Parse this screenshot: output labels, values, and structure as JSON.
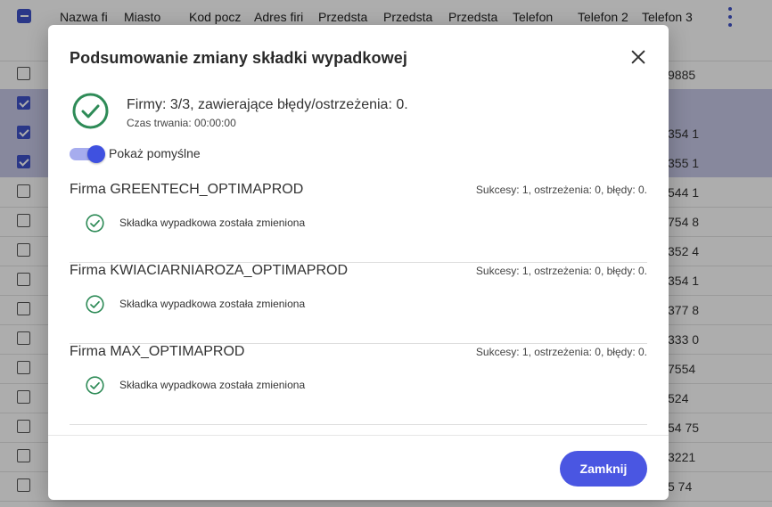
{
  "grid": {
    "columns": [
      "Nazwa fi",
      "Miasto",
      "Kod pocz",
      "Adres firi",
      "Przedsta",
      "Przedsta",
      "Przedsta",
      "Telefon",
      "Telefon 2",
      "Telefon 3"
    ],
    "rows": [
      {
        "checked": false,
        "selected": false,
        "value": "9885"
      },
      {
        "checked": true,
        "selected": true,
        "value": ""
      },
      {
        "checked": true,
        "selected": true,
        "value": "354 1"
      },
      {
        "checked": true,
        "selected": true,
        "value": "355 1"
      },
      {
        "checked": false,
        "selected": false,
        "value": "544 1"
      },
      {
        "checked": false,
        "selected": false,
        "value": "754 8"
      },
      {
        "checked": false,
        "selected": false,
        "value": "352 4"
      },
      {
        "checked": false,
        "selected": false,
        "value": "354 1"
      },
      {
        "checked": false,
        "selected": false,
        "value": "377 8"
      },
      {
        "checked": false,
        "selected": false,
        "value": "333 0"
      },
      {
        "checked": false,
        "selected": false,
        "value": "7554"
      },
      {
        "checked": false,
        "selected": false,
        "value": "524"
      },
      {
        "checked": false,
        "selected": false,
        "value": "54 75"
      },
      {
        "checked": false,
        "selected": false,
        "value": "3221"
      },
      {
        "checked": false,
        "selected": false,
        "value": "5 74"
      }
    ]
  },
  "modal": {
    "title": "Podsumowanie zmiany składki wypadkowej",
    "summary": "Firmy: 3/3, zawierające błędy/ostrzeżenia: 0.",
    "duration": "Czas trwania: 00:00:00",
    "toggle_label": "Pokaż pomyślne",
    "toggle_on": true,
    "firms": [
      {
        "name": "Firma GREENTECH_OPTIMAPROD",
        "stats": "Sukcesy: 1, ostrzeżenia: 0, błędy: 0.",
        "message": "Składka wypadkowa została zmieniona"
      },
      {
        "name": "Firma KWIACIARNIAROZA_OPTIMAPROD",
        "stats": "Sukcesy: 1, ostrzeżenia: 0, błędy: 0.",
        "message": "Składka wypadkowa została zmieniona"
      },
      {
        "name": "Firma MAX_OPTIMAPROD",
        "stats": "Sukcesy: 1, ostrzeżenia: 0, błędy: 0.",
        "message": "Składka wypadkowa została zmieniona"
      }
    ],
    "close_label": "Zamknij"
  },
  "colors": {
    "accent": "#4a56e2",
    "success": "#2e8b57",
    "selected_row": "#c7c9e8"
  },
  "icons": {
    "summary": "check-circle-icon",
    "close": "close-icon",
    "menu": "kebab-menu-icon"
  }
}
